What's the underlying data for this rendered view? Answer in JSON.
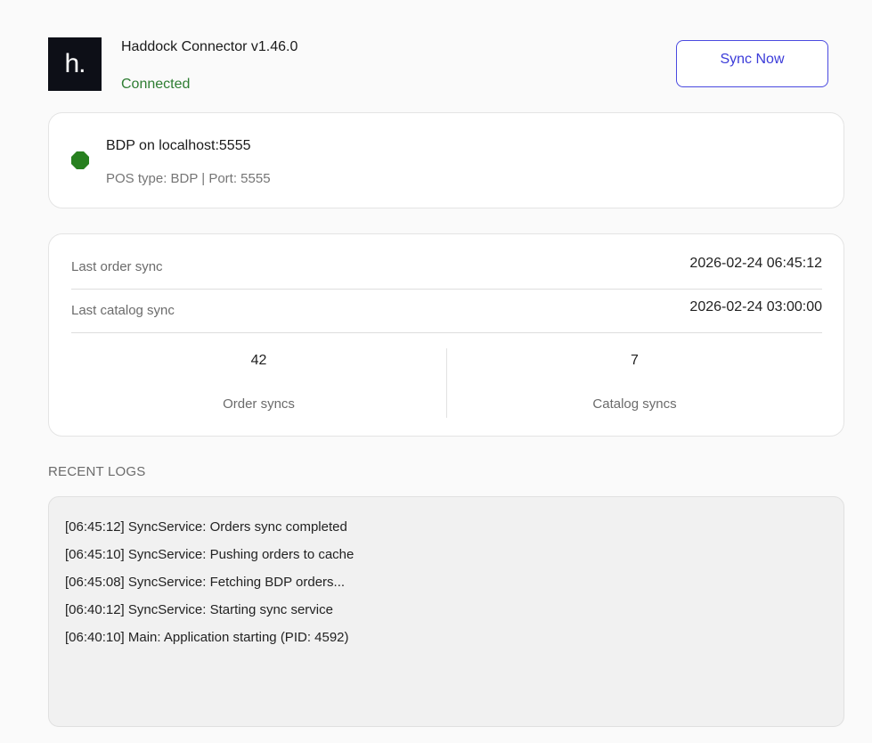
{
  "header": {
    "logo_text": "h.",
    "app_title": "Haddock Connector v1.46.0",
    "status": "Connected",
    "sync_button_label": "Sync Now"
  },
  "pos": {
    "name": "BDP on localhost:5555",
    "meta": "POS type: BDP | Port: 5555",
    "status_color": "#27801f"
  },
  "stats": {
    "rows": [
      {
        "label": "Last order sync",
        "value": "2026-02-24 06:45:12"
      },
      {
        "label": "Last catalog sync",
        "value": "2026-02-24 03:00:00"
      }
    ],
    "counters": [
      {
        "value": "42",
        "label": "Order syncs"
      },
      {
        "value": "7",
        "label": "Catalog syncs"
      }
    ]
  },
  "logs": {
    "heading": "RECENT LOGS",
    "lines": [
      "[06:45:12] SyncService: Orders sync completed",
      "[06:45:10] SyncService: Pushing orders to cache",
      "[06:45:08] SyncService: Fetching BDP orders...",
      "[06:40:12] SyncService: Starting sync service",
      "[06:40:10] Main: Application starting (PID: 4592)"
    ]
  },
  "colors": {
    "accent": "#3b3bd9",
    "connected": "#2e7d32",
    "logo_bg": "#0d0f17"
  }
}
